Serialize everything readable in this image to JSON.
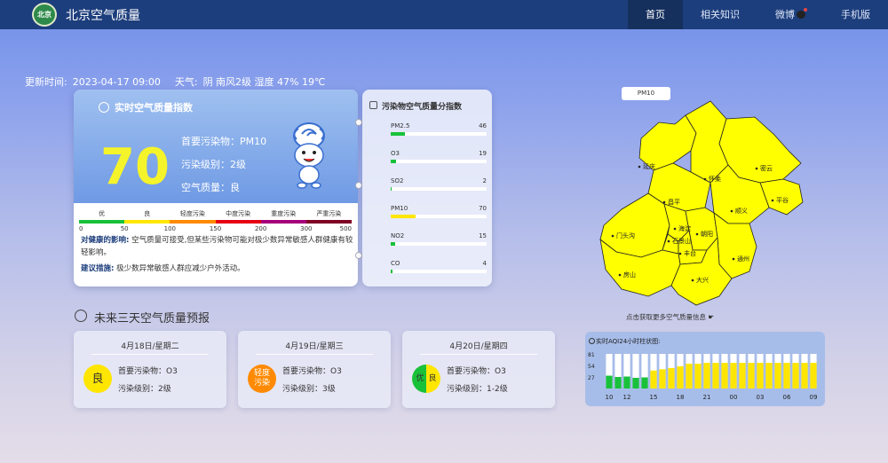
{
  "header": {
    "logo_text": "北京",
    "site_title": "北京空气质量",
    "nav": [
      {
        "label": "首页",
        "active": true
      },
      {
        "label": "相关知识",
        "active": false
      },
      {
        "label": "微博",
        "active": false
      },
      {
        "label": "手机版",
        "active": false
      }
    ]
  },
  "status": {
    "updated_label": "更新时间:",
    "updated_value": "2023-04-17 09:00",
    "weather_label": "天气:",
    "weather_value": "阴 南风2级 湿度 47% 19℃"
  },
  "realtime": {
    "title": "实时空气质量指数",
    "aqi": "70",
    "primary_pollutant": "首要污染物：PM10",
    "level": "污染级别：2级",
    "quality": "空气质量：良",
    "scale_labels": [
      "优",
      "良",
      "轻度污染",
      "中度污染",
      "重度污染",
      "严重污染"
    ],
    "scale_colors": [
      "#19c13a",
      "#ffe600",
      "#ff8a00",
      "#e60012",
      "#a4007a",
      "#7e0023"
    ],
    "scale_numbers": [
      "0",
      "50",
      "100",
      "150",
      "200",
      "300",
      "500"
    ],
    "health_label": "对健康的影响:",
    "health_text": "空气质量可接受,但某些污染物可能对极少数异常敏感人群健康有较轻影响。",
    "advice_label": "建议措施:",
    "advice_text": "极少数异常敏感人群应减少户外活动。",
    "mascot": "cloud-mascot"
  },
  "sub_index": {
    "title": "污染物空气质量分指数",
    "items": [
      {
        "name": "PM2.5",
        "value": "46",
        "fraction": 0.15,
        "color": "#19c13a"
      },
      {
        "name": "O3",
        "value": "19",
        "fraction": 0.06,
        "color": "#19c13a"
      },
      {
        "name": "SO2",
        "value": "2",
        "fraction": 0.01,
        "color": "#19c13a"
      },
      {
        "name": "PM10",
        "value": "70",
        "fraction": 0.26,
        "color": "#ffe600"
      },
      {
        "name": "NO2",
        "value": "15",
        "fraction": 0.05,
        "color": "#19c13a"
      },
      {
        "name": "CO",
        "value": "4",
        "fraction": 0.02,
        "color": "#19c13a"
      }
    ]
  },
  "map": {
    "tab_label": "PM10",
    "districts": [
      "延庆",
      "怀柔",
      "密云",
      "昌平",
      "顺义",
      "平谷",
      "门头沟",
      "海淀",
      "朝阳",
      "石景山",
      "丰台",
      "通州",
      "房山",
      "大兴"
    ],
    "fill_color": "#ffff00",
    "link_text": "点击获取更多空气质量信息"
  },
  "forecast": {
    "title": "未来三天空气质量预报",
    "days": [
      {
        "date": "4月18日/星期二",
        "badge": "良",
        "pollutant": "首要污染物：O3",
        "level": "污染级别：2级"
      },
      {
        "date": "4月19日/星期三",
        "badge": "轻度污染",
        "pollutant": "首要污染物：O3",
        "level": "污染级别：3级"
      },
      {
        "date": "4月20日/星期四",
        "badge_left": "优",
        "badge_right": "良",
        "pollutant": "首要污染物：O3",
        "level": "污染级别：1-2级"
      }
    ]
  },
  "hourly": {
    "title": "实时AQI24小时柱状图:",
    "y_ticks": [
      "81",
      "54",
      "27"
    ],
    "x_ticks": [
      "10",
      "12",
      "15",
      "18",
      "21",
      "00",
      "03",
      "06",
      "09"
    ]
  },
  "chart_data": {
    "type": "bar",
    "title": "实时AQI24小时柱状图:",
    "ylim": [
      0,
      81
    ],
    "categories": [
      "10",
      "11",
      "12",
      "13",
      "14",
      "15",
      "16",
      "17",
      "18",
      "19",
      "20",
      "21",
      "22",
      "23",
      "00",
      "01",
      "02",
      "03",
      "04",
      "05",
      "06",
      "07",
      "08",
      "09"
    ],
    "values": [
      30,
      27,
      28,
      25,
      26,
      42,
      45,
      48,
      52,
      58,
      58,
      60,
      60,
      60,
      60,
      60,
      60,
      60,
      60,
      60,
      60,
      60,
      60,
      60
    ],
    "colors": [
      "#19c13a",
      "#19c13a",
      "#19c13a",
      "#19c13a",
      "#19c13a",
      "#ffe600",
      "#ffe600",
      "#ffe600",
      "#ffe600",
      "#ffe600",
      "#ffe600",
      "#ffe600",
      "#ffe600",
      "#ffe600",
      "#ffe600",
      "#ffe600",
      "#ffe600",
      "#ffe600",
      "#ffe600",
      "#ffe600",
      "#ffe600",
      "#ffe600",
      "#ffe600",
      "#ffe600"
    ]
  }
}
